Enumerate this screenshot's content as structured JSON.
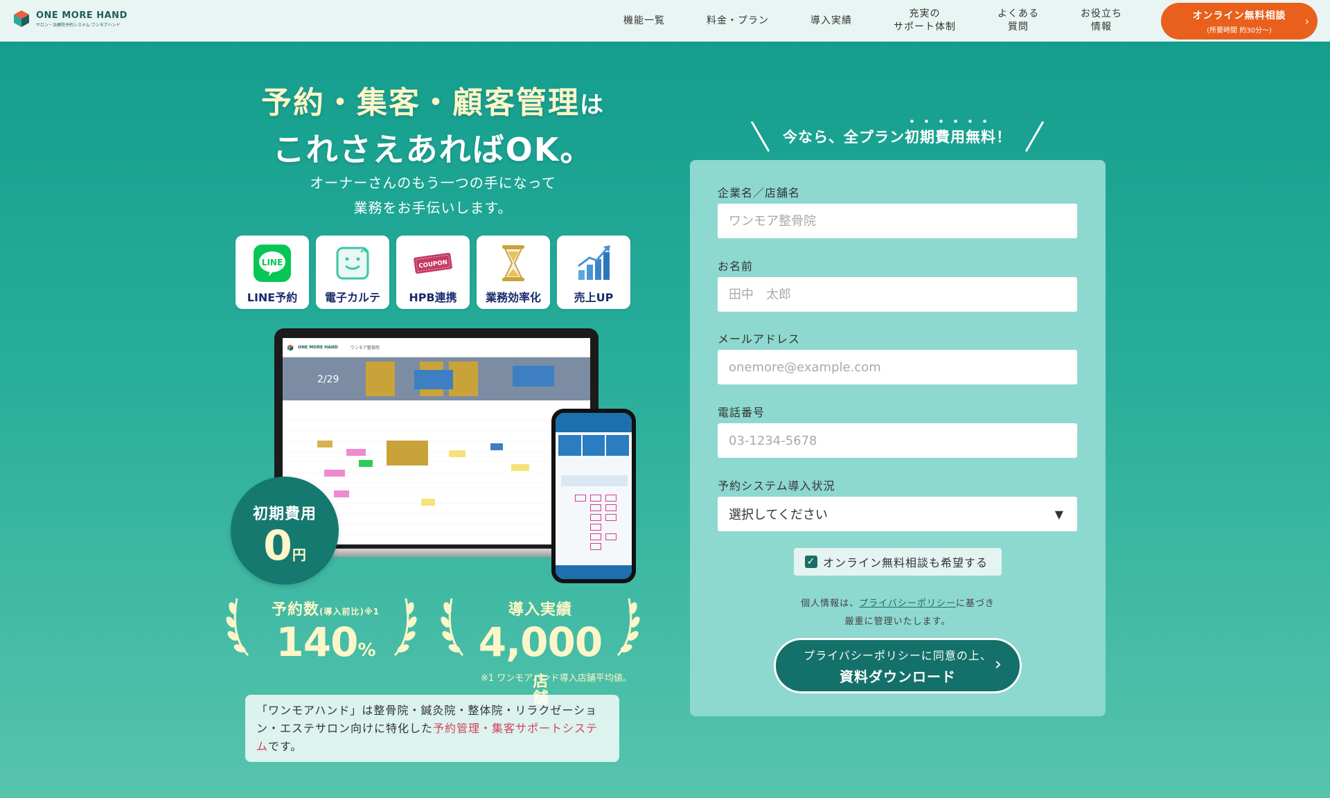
{
  "header": {
    "logo_main": "ONE MORE HAND",
    "logo_sub": "サロン・治療院予約システム ワンモアハンド",
    "nav": [
      {
        "label": "機能一覧"
      },
      {
        "label": "料金・プラン"
      },
      {
        "label": "導入実績"
      },
      {
        "label": "充実の\nサポート体制"
      },
      {
        "label": "よくある\n質問"
      },
      {
        "label": "お役立ち\n情報"
      }
    ],
    "cta_line1": "オンライン無料相談",
    "cta_line2": "(所要時間 約30分〜)",
    "cta_arrow": "›"
  },
  "hero": {
    "title_part1": "予約・集客・顧客管理",
    "title_part2": "は",
    "title_line2": "これさえあればOK。",
    "subtitle_line1": "オーナーさんのもう一つの手になって",
    "subtitle_line2": "業務をお手伝いします。"
  },
  "features": [
    {
      "label": "LINE予約",
      "icon": "line-icon"
    },
    {
      "label": "電子カルテ",
      "icon": "tablet-chart-icon"
    },
    {
      "label": "HPB連携",
      "icon": "coupon-icon",
      "icon_text": "COUPON"
    },
    {
      "label": "業務効率化",
      "icon": "hourglass-icon"
    },
    {
      "label": "売上UP",
      "icon": "bar-chart-up-icon"
    }
  ],
  "mockup": {
    "laptop_brand": "ONE MORE HAND",
    "laptop_store": "ワンモア整骨院",
    "laptop_date": "2/29"
  },
  "cost": {
    "title": "初期費用",
    "number": "0",
    "unit": "円"
  },
  "stats": {
    "reservations": {
      "caption": "予約数",
      "caption_small": "(導入前比)",
      "note_mark": "※1",
      "value": "140",
      "unit": "%"
    },
    "introductions": {
      "caption": "導入実績",
      "value": "4,000",
      "unit": "店舗"
    }
  },
  "note": "※1 ワンモアハンド導入店舗平均値。",
  "description": {
    "part1": "「ワンモアハンド」は整骨院・鍼灸院・整体院・リラクゼーション・エステサロン向けに特化した",
    "highlight": "予約管理・集客サポートシステム",
    "part2": "です。"
  },
  "form": {
    "heading": "今なら、全プラン初期費用無料！",
    "fields": [
      {
        "label": "企業名／店舗名",
        "placeholder": "ワンモア整骨院"
      },
      {
        "label": "お名前",
        "placeholder": "田中　太郎"
      },
      {
        "label": "メールアドレス",
        "placeholder": "onemore@example.com"
      },
      {
        "label": "電話番号",
        "placeholder": "03-1234-5678"
      }
    ],
    "select_label": "予約システム導入状況",
    "select_value": "選択してください",
    "checkbox_label": "オンライン無料相談も希望する",
    "privacy_pre": "個人情報は、",
    "privacy_link": "プライバシーポリシー",
    "privacy_post": "に基づき",
    "privacy_line2": "厳重に管理いたします。",
    "submit_line1": "プライバシーポリシーに同意の上、",
    "submit_line2": "資料ダウンロード"
  },
  "colors": {
    "brand": "#14706a",
    "cta": "#e8601c",
    "accent_text": "#fdf6c8",
    "highlight": "#d6405a"
  }
}
